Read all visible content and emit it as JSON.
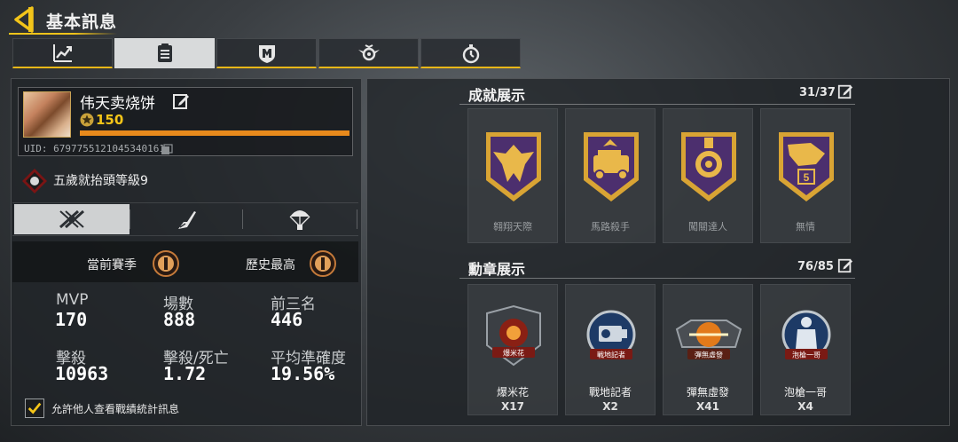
{
  "header": {
    "title": "基本訊息"
  },
  "tabs": [
    {
      "icon": "stats-chart-icon"
    },
    {
      "icon": "clipboard-icon"
    },
    {
      "icon": "shield-badge-icon"
    },
    {
      "icon": "wings-emblem-icon"
    },
    {
      "icon": "stopwatch-icon"
    }
  ],
  "profile": {
    "name": "伟天卖烧饼",
    "level": "150",
    "uid": "UID: 6797755121045340161",
    "rank_name": "五歲就抬頭等級9"
  },
  "season": {
    "current_label": "當前賽季",
    "best_label": "歷史最高"
  },
  "stats": [
    {
      "label": "MVP",
      "value": "170"
    },
    {
      "label": "場數",
      "value": "888"
    },
    {
      "label": "前三名",
      "value": "446"
    },
    {
      "label": "擊殺",
      "value": "10963"
    },
    {
      "label": "擊殺/死亡",
      "value": "1.72"
    },
    {
      "label": "平均準確度",
      "value": "19.56%"
    }
  ],
  "allow_others": {
    "label": "允許他人查看戰績統計訊息",
    "checked": true
  },
  "achievements": {
    "title": "成就展示",
    "count": "31/37",
    "items": [
      {
        "name": "翱翔天際"
      },
      {
        "name": "馬路殺手"
      },
      {
        "name": "闖關達人"
      },
      {
        "name": "無情"
      }
    ]
  },
  "medals": {
    "title": "勳章展示",
    "count": "76/85",
    "items": [
      {
        "name": "爆米花",
        "badge": "爆米花",
        "count": "X17"
      },
      {
        "name": "戰地記者",
        "badge": "戰地記者",
        "count": "X2"
      },
      {
        "name": "彈無虛發",
        "badge": "彈無虛發",
        "count": "X41"
      },
      {
        "name": "泡槍一哥",
        "badge": "泡槍一哥",
        "count": "X4"
      }
    ]
  },
  "colors": {
    "accent": "#e8b718",
    "xp": "#e88a1c",
    "gold": "#f5c518"
  }
}
